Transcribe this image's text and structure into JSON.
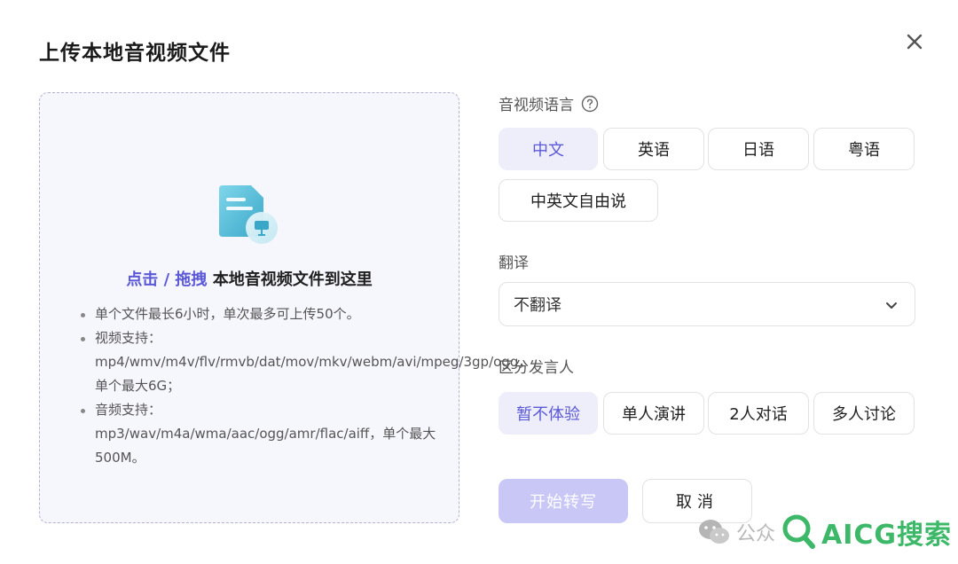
{
  "dialog": {
    "title": "上传本地音视频文件",
    "close_icon": "close-icon"
  },
  "dropzone": {
    "icon": "file-upload-icon",
    "link_click": "点击",
    "separator": " / ",
    "link_drag": "拖拽",
    "headline_rest": " 本地音视频文件到这里",
    "notes": [
      "单个文件最长6小时，单次最多可上传50个。",
      "视频支持：mp4/wmv/m4v/flv/rmvb/dat/mov/mkv/webm/avi/mpeg/3gp/ogg，单个最大6G；",
      "音频支持：mp3/wav/m4a/wma/aac/ogg/amr/flac/aiff，单个最大500M。"
    ]
  },
  "language": {
    "label": "音视频语言",
    "help_icon": "help-circle-icon",
    "options": [
      "中文",
      "英语",
      "日语",
      "粤语",
      "中英文自由说"
    ],
    "selected": "中文"
  },
  "translation": {
    "label": "翻译",
    "value": "不翻译",
    "icon": "chevron-down-icon"
  },
  "speaker": {
    "label": "区分发言人",
    "options": [
      "暂不体验",
      "单人演讲",
      "2人对话",
      "多人讨论"
    ],
    "selected": "暂不体验"
  },
  "actions": {
    "start_label": "开始转写",
    "cancel_label": "取消"
  },
  "watermark": {
    "text1": "公众",
    "text2": "AICG搜索"
  },
  "colors": {
    "accent": "#5b59d6",
    "accent_soft": "#eeeefb",
    "primary_disabled": "#c9c7f5",
    "watermark_green": "#3db869"
  }
}
